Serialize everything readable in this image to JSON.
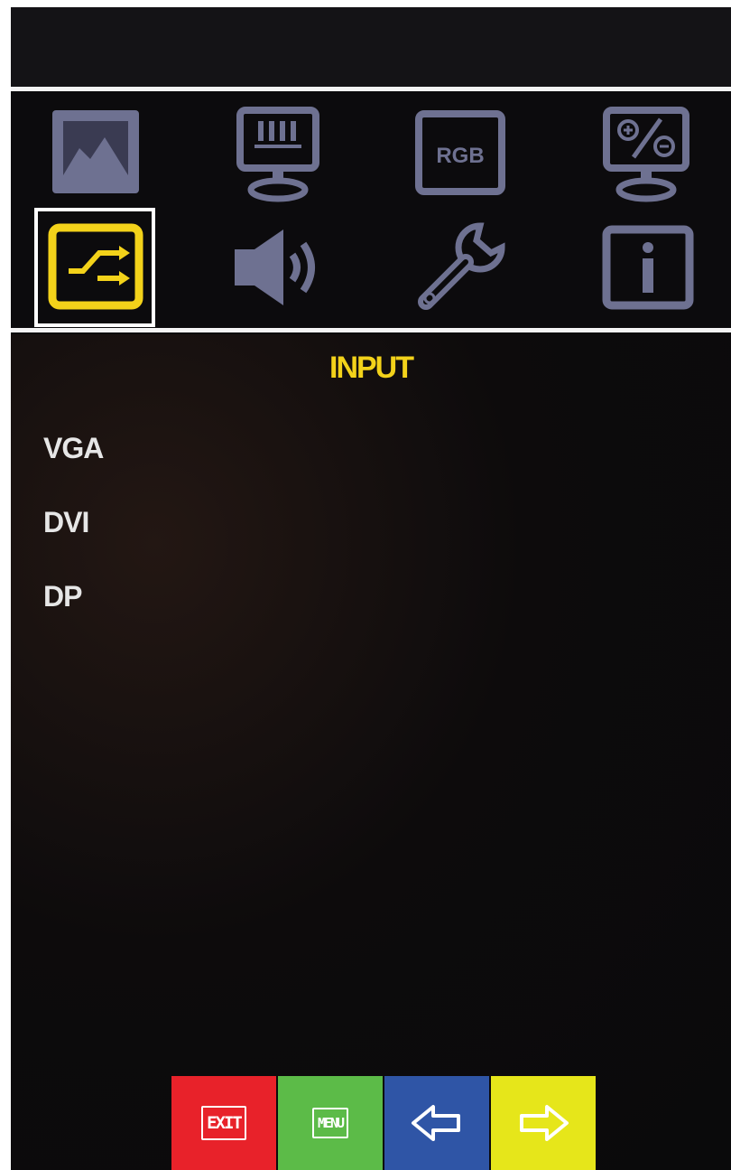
{
  "window": {
    "title": ""
  },
  "colors": {
    "selected": "#f3d21a",
    "icon_inactive": "#6e7191",
    "exit_button": "#e8222a",
    "menu_button": "#5cbb48",
    "left_button": "#2f55a6",
    "right_button": "#e6e61a"
  },
  "menu_icons": [
    {
      "name": "picture-icon",
      "label": ""
    },
    {
      "name": "display-icon",
      "label": ""
    },
    {
      "name": "rgb-icon",
      "label": "RGB"
    },
    {
      "name": "zoom-icon",
      "label": ""
    },
    {
      "name": "input-icon",
      "label": "",
      "selected": true
    },
    {
      "name": "audio-icon",
      "label": ""
    },
    {
      "name": "setup-icon",
      "label": ""
    },
    {
      "name": "info-icon",
      "label": ""
    }
  ],
  "panel": {
    "title": "INPUT",
    "items": [
      "VGA",
      "DVI",
      "DP"
    ]
  },
  "buttons": {
    "exit": "EXIT",
    "menu": "MENU",
    "left": "left-arrow-icon",
    "right": "right-arrow-icon"
  }
}
